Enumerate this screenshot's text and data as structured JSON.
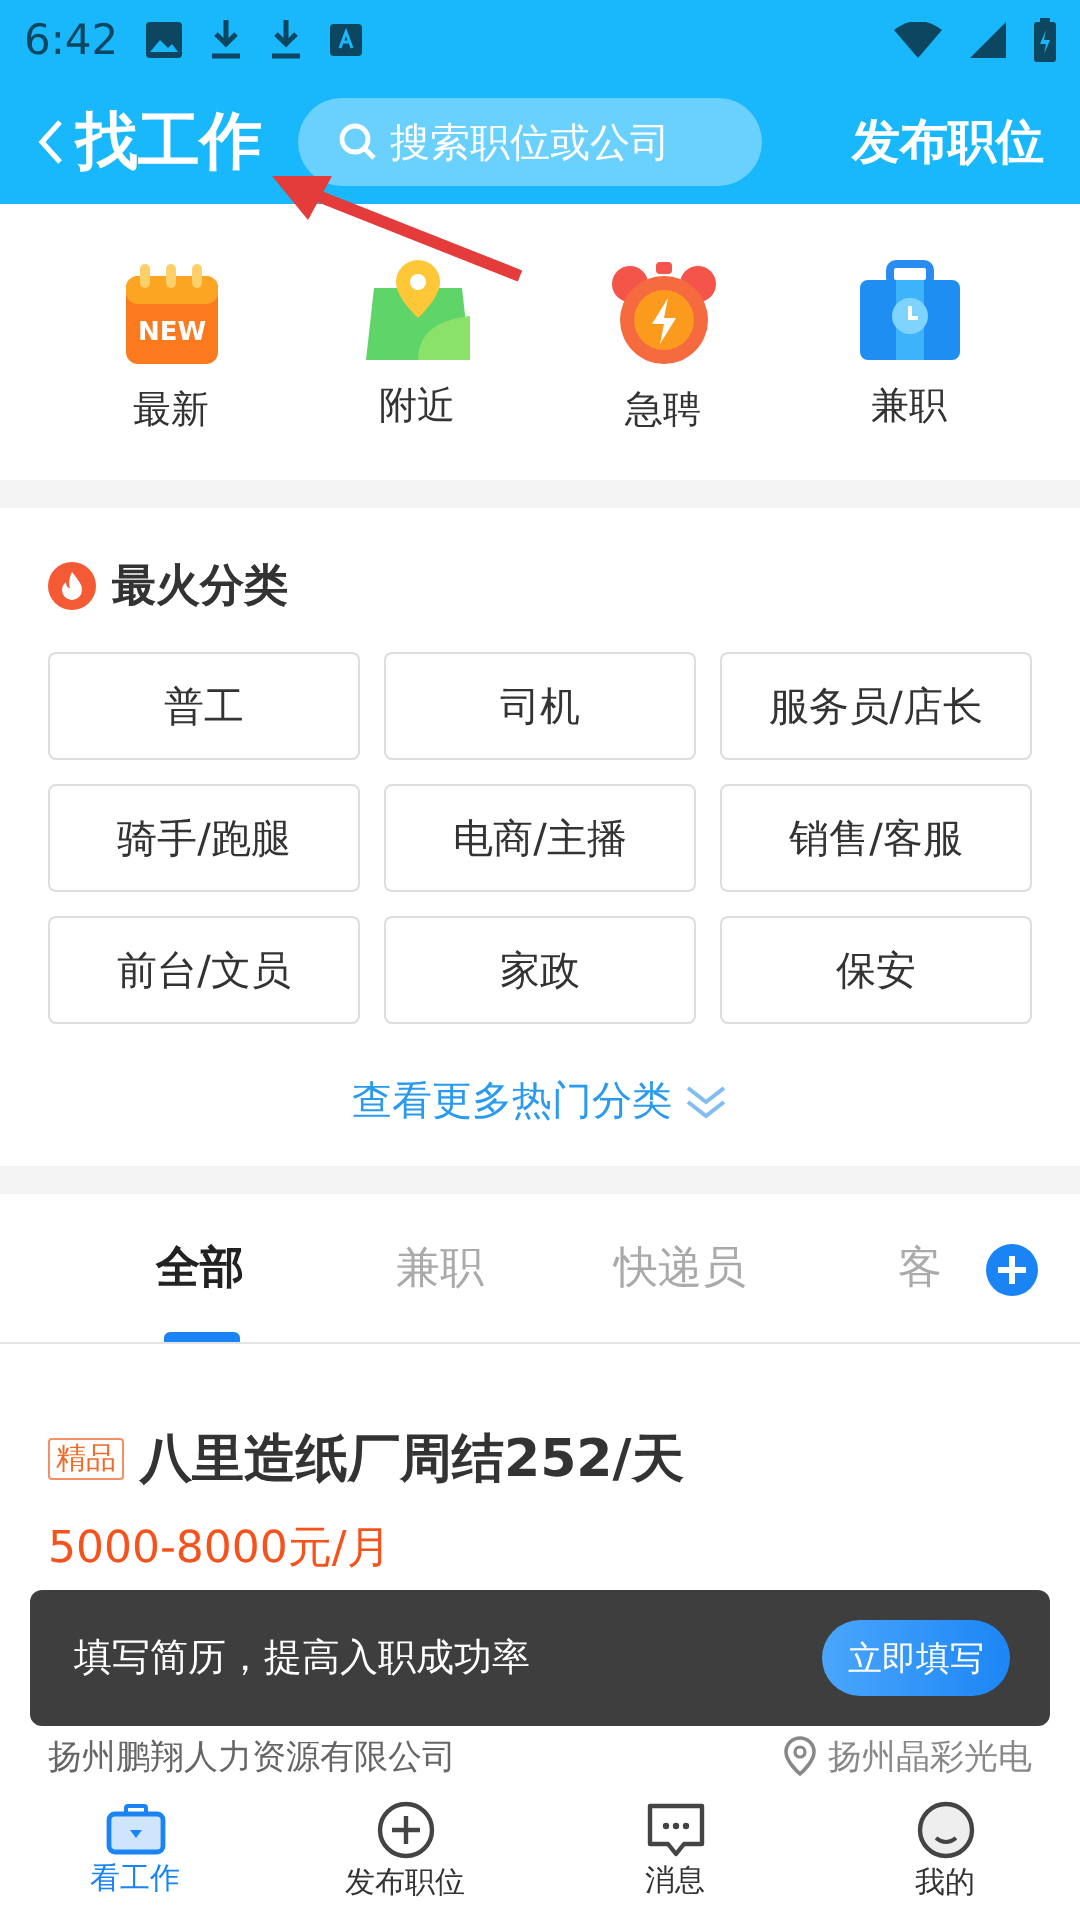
{
  "status_bar": {
    "time": "6:42"
  },
  "header": {
    "title": "找工作",
    "search": {
      "placeholder": "搜索职位或公司"
    },
    "action": "发布职位"
  },
  "quick_entries": [
    {
      "kind": "new",
      "label": "最新",
      "badge": "NEW"
    },
    {
      "kind": "map",
      "label": "附近"
    },
    {
      "kind": "alarm",
      "label": "急聘"
    },
    {
      "kind": "briefcase",
      "label": "兼职"
    }
  ],
  "hot_categories": {
    "title": "最火分类",
    "items": [
      "普工",
      "司机",
      "服务员/店长",
      "骑手/跑腿",
      "电商/主播",
      "销售/客服",
      "前台/文员",
      "家政",
      "保安"
    ],
    "more": "查看更多热门分类"
  },
  "job_tabs": [
    {
      "label": "全部",
      "selected": true
    },
    {
      "label": "兼职",
      "selected": false
    },
    {
      "label": "快递员",
      "selected": false
    },
    {
      "label": "客",
      "selected": false
    }
  ],
  "job": {
    "tag": "精品",
    "title": "八里造纸厂周结252/天",
    "salary": "5000-8000元/月",
    "company": "扬州鹏翔人力资源有限公司",
    "location": "扬州晶彩光电"
  },
  "toast": {
    "message": "填写简历，提高入职成功率",
    "button": "立即填写"
  },
  "bottom_nav": [
    {
      "kind": "work",
      "label": "看工作",
      "selected": true
    },
    {
      "kind": "post",
      "label": "发布职位",
      "selected": false
    },
    {
      "kind": "message",
      "label": "消息",
      "selected": false
    },
    {
      "kind": "me",
      "label": "我的",
      "selected": false
    }
  ]
}
